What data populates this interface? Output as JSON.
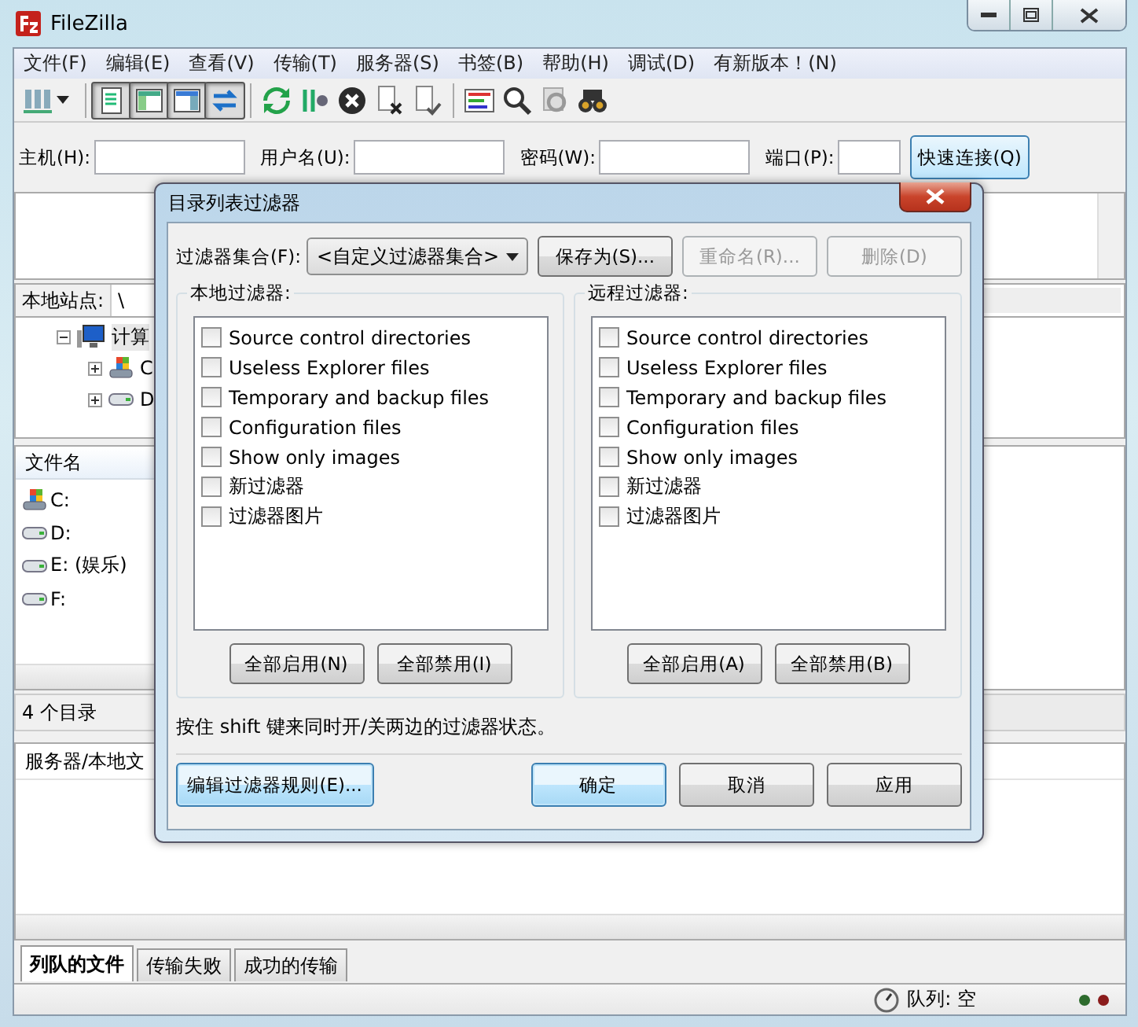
{
  "window": {
    "title": "FileZilla"
  },
  "menu": [
    "文件(F)",
    "编辑(E)",
    "查看(V)",
    "传输(T)",
    "服务器(S)",
    "书签(B)",
    "帮助(H)",
    "调试(D)",
    "有新版本！(N)"
  ],
  "toolbar": {
    "toggles": [
      {
        "pressed": true
      },
      {
        "pressed": true
      },
      {
        "pressed": true
      },
      {
        "pressed": true
      }
    ]
  },
  "quickconnect": {
    "fields": [
      {
        "label": "主机(H):"
      },
      {
        "label": "用户名(U):"
      },
      {
        "label": "密码(W):"
      },
      {
        "label": "端口(P):"
      }
    ],
    "button": "快速连接(Q)"
  },
  "local_site": {
    "label": "本地站点:",
    "value": "\\"
  },
  "tree": [
    {
      "label": "计算",
      "expanded": true,
      "selected": true,
      "children": [
        {
          "label": "C",
          "kind": "system",
          "expanded": false,
          "selected": false
        },
        {
          "label": "D",
          "kind": "drive",
          "expanded": false,
          "selected": false
        }
      ]
    }
  ],
  "file_list": {
    "column": "文件名",
    "rows": [
      {
        "name": "C:",
        "kind": "system"
      },
      {
        "name": "D:",
        "kind": "drive"
      },
      {
        "name": "E: (娱乐)",
        "kind": "drive"
      },
      {
        "name": "F:",
        "kind": "drive"
      }
    ],
    "status": "4 个目录"
  },
  "queue": {
    "column": "服务器/本地文"
  },
  "tabs": [
    {
      "label": "列队的文件",
      "selected": true
    },
    {
      "label": "传输失败",
      "selected": false
    },
    {
      "label": "成功的传输",
      "selected": false
    }
  ],
  "status_bar": {
    "queue": "队列: 空"
  },
  "dialog": {
    "title": "目录列表过滤器",
    "filter_set": {
      "label": "过滤器集合(F):",
      "value": "<自定义过滤器集合>"
    },
    "top_buttons": [
      {
        "label": "保存为(S)...",
        "disabled": false
      },
      {
        "label": "重命名(R)...",
        "disabled": true
      },
      {
        "label": "删除(D)",
        "disabled": true
      }
    ],
    "panels": [
      {
        "legend": "本地过滤器:",
        "filters": [
          {
            "label": "Source control directories",
            "checked": false
          },
          {
            "label": "Useless Explorer files",
            "checked": false
          },
          {
            "label": "Temporary and backup files",
            "checked": false
          },
          {
            "label": "Configuration files",
            "checked": false
          },
          {
            "label": "Show only images",
            "checked": false
          },
          {
            "label": "新过滤器",
            "checked": false
          },
          {
            "label": "过滤器图片",
            "checked": false
          }
        ],
        "buttons": [
          "全部启用(N)",
          "全部禁用(I)"
        ]
      },
      {
        "legend": "远程过滤器:",
        "filters": [
          {
            "label": "Source control directories",
            "checked": false
          },
          {
            "label": "Useless Explorer files",
            "checked": false
          },
          {
            "label": "Temporary and backup files",
            "checked": false
          },
          {
            "label": "Configuration files",
            "checked": false
          },
          {
            "label": "Show only images",
            "checked": false
          },
          {
            "label": "新过滤器",
            "checked": false
          },
          {
            "label": "过滤器图片",
            "checked": false
          }
        ],
        "buttons": [
          "全部启用(A)",
          "全部禁用(B)"
        ]
      }
    ],
    "hint": "按住 shift 键来同时开/关两边的过滤器状态。",
    "footer_buttons": [
      {
        "label": "编辑过滤器规则(E)...",
        "focused": true
      },
      {
        "label": "确定",
        "focused": true
      },
      {
        "label": "取消",
        "focused": false
      },
      {
        "label": "应用",
        "focused": false
      }
    ]
  }
}
